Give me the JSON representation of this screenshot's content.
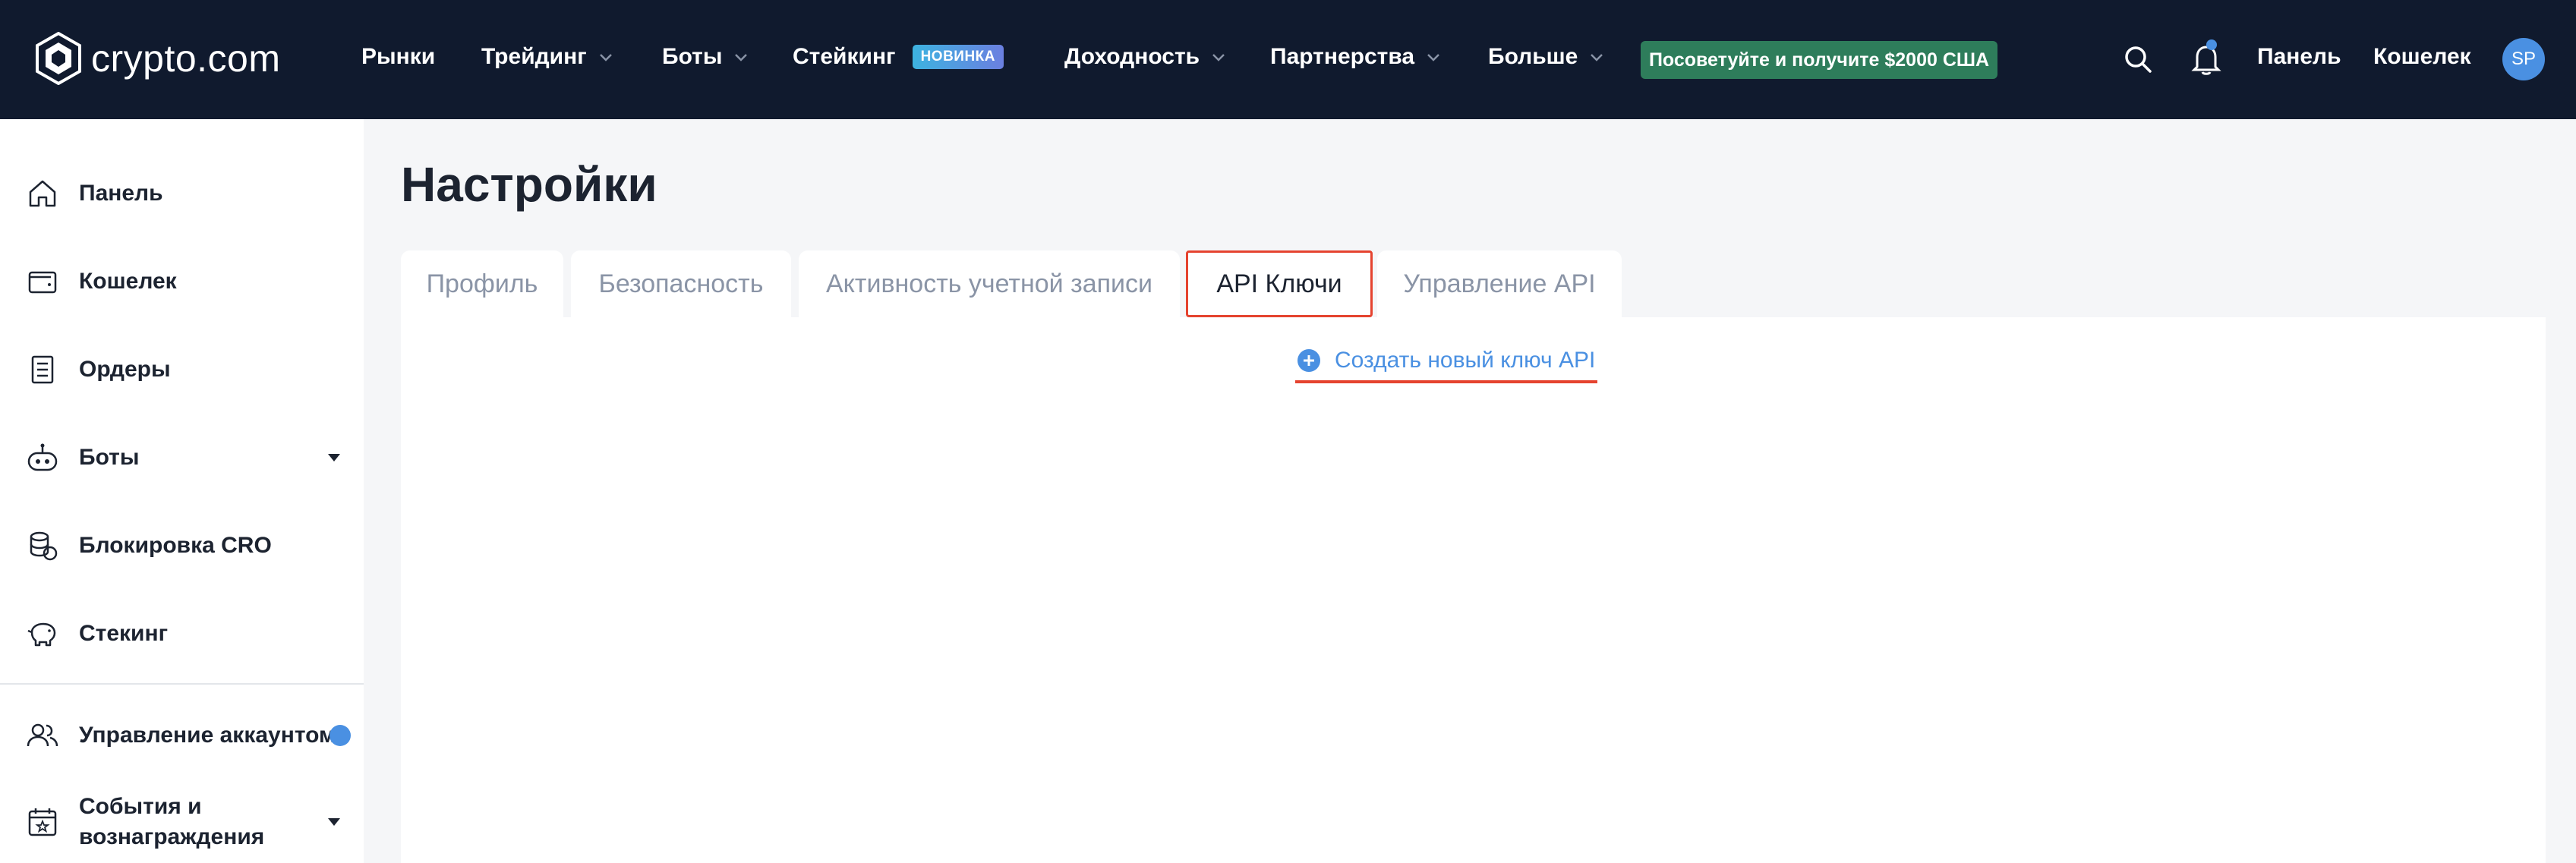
{
  "brand": {
    "name": "crypto.com"
  },
  "nav": {
    "items": [
      {
        "label": "Рынки",
        "has_dropdown": false
      },
      {
        "label": "Трейдинг",
        "has_dropdown": true
      },
      {
        "label": "Боты",
        "has_dropdown": true
      },
      {
        "label": "Стейкинг",
        "has_dropdown": false,
        "badge": "НОВИНКА"
      },
      {
        "label": "Доходность",
        "has_dropdown": true
      },
      {
        "label": "Партнерства",
        "has_dropdown": true
      },
      {
        "label": "Больше",
        "has_dropdown": true
      }
    ],
    "promo": "Посоветуйте и получите $2000 США",
    "right": {
      "search_icon": "search-icon",
      "bell_icon": "bell-icon",
      "dashboard_link": "Панель",
      "wallet_link": "Кошелек",
      "avatar_initials": "SP"
    }
  },
  "sidebar": {
    "items": [
      {
        "label": "Панель",
        "icon": "home-icon"
      },
      {
        "label": "Кошелек",
        "icon": "wallet-icon"
      },
      {
        "label": "Ордеры",
        "icon": "orders-icon"
      },
      {
        "label": "Боты",
        "icon": "bot-icon",
        "expandable": true
      },
      {
        "label": "Блокировка CRO",
        "icon": "coins-icon"
      },
      {
        "label": "Стекинг",
        "icon": "piggy-bank-icon"
      },
      {
        "label": "Управление аккаунтом",
        "icon": "users-icon",
        "dot": true
      },
      {
        "label": "События и вознаграждения",
        "icon": "calendar-star-icon",
        "expandable": true
      }
    ]
  },
  "main": {
    "title": "Настройки",
    "tabs": [
      {
        "label": "Профиль",
        "active": false
      },
      {
        "label": "Безопасность",
        "active": false
      },
      {
        "label": "Активность учетной записи",
        "active": false
      },
      {
        "label": "API Ключи",
        "active": true
      },
      {
        "label": "Управление API",
        "active": false
      }
    ],
    "create_key_label": "Создать новый ключ API"
  },
  "colors": {
    "topbar_bg": "#101a2e",
    "accent_blue": "#4a90e2",
    "promo_green": "#2e7d5b",
    "highlight_red": "#e5432f"
  }
}
